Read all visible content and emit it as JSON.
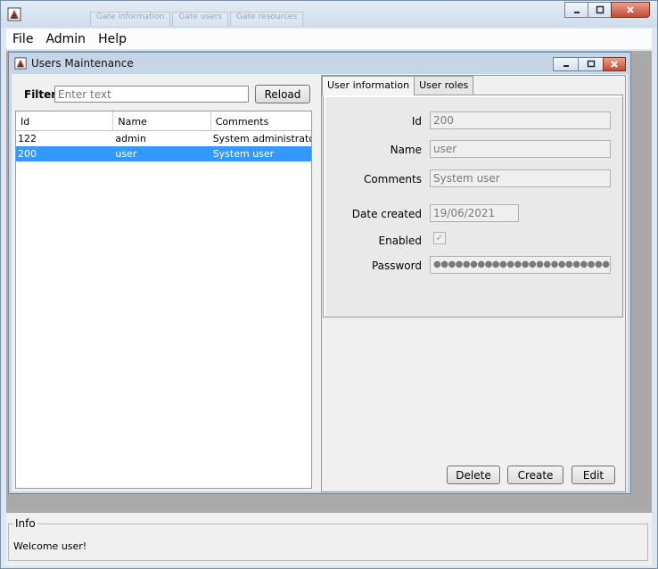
{
  "window": {
    "ghost_tabs": [
      "Gate information",
      "Gate users",
      "Gate resources"
    ]
  },
  "menu": {
    "items": [
      "File",
      "Admin",
      "Help"
    ]
  },
  "internal_frame": {
    "title": "Users Maintenance"
  },
  "filter": {
    "label": "Filter",
    "placeholder": "Enter text"
  },
  "reload_label": "Reload",
  "table": {
    "headers": [
      "Id",
      "Name",
      "Comments"
    ],
    "rows": [
      {
        "id": "122",
        "name": "admin",
        "comments": "System administrator",
        "selected": false
      },
      {
        "id": "200",
        "name": "user",
        "comments": "System user",
        "selected": true
      }
    ]
  },
  "tabs": [
    "User information",
    "User roles"
  ],
  "form": {
    "id_label": "Id",
    "id_value": "200",
    "name_label": "Name",
    "name_value": "user",
    "comments_label": "Comments",
    "comments_value": "System user",
    "date_label": "Date created",
    "date_value": "19/06/2021",
    "enabled_label": "Enabled",
    "enabled_checked": true,
    "password_label": "Password",
    "password_value": "●●●●●●●●●●●●●●●●●●●●●●●●●●●●"
  },
  "buttons": {
    "delete": "Delete",
    "create": "Create",
    "edit": "Edit"
  },
  "info": {
    "title": "Info",
    "message": "Welcome user!"
  },
  "colors": {
    "selection": "#3399ff",
    "close_button": "#c54b32"
  }
}
